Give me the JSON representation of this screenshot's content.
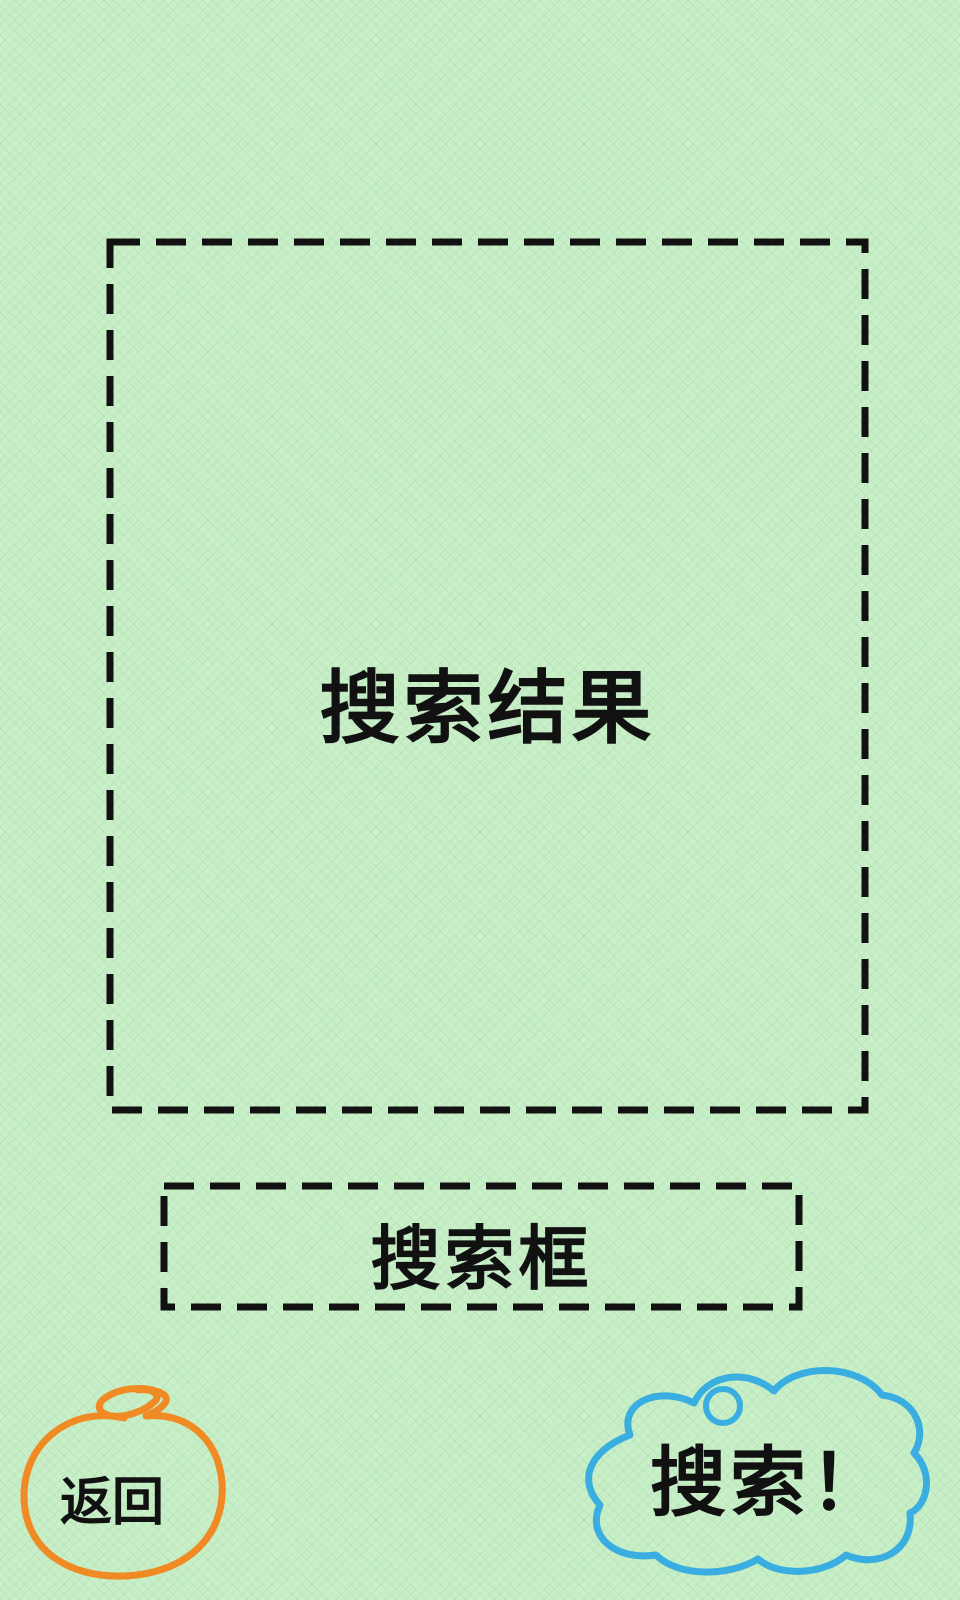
{
  "results_area": {
    "label": "搜索结果"
  },
  "search_box": {
    "label": "搜索框"
  },
  "back_button": {
    "label": "返回"
  },
  "search_button": {
    "label": "搜索！"
  },
  "colors": {
    "background": "#c9efc9",
    "dash_stroke": "#111111",
    "back_button_outline": "#f08a24",
    "search_button_outline": "#3aaee0"
  }
}
